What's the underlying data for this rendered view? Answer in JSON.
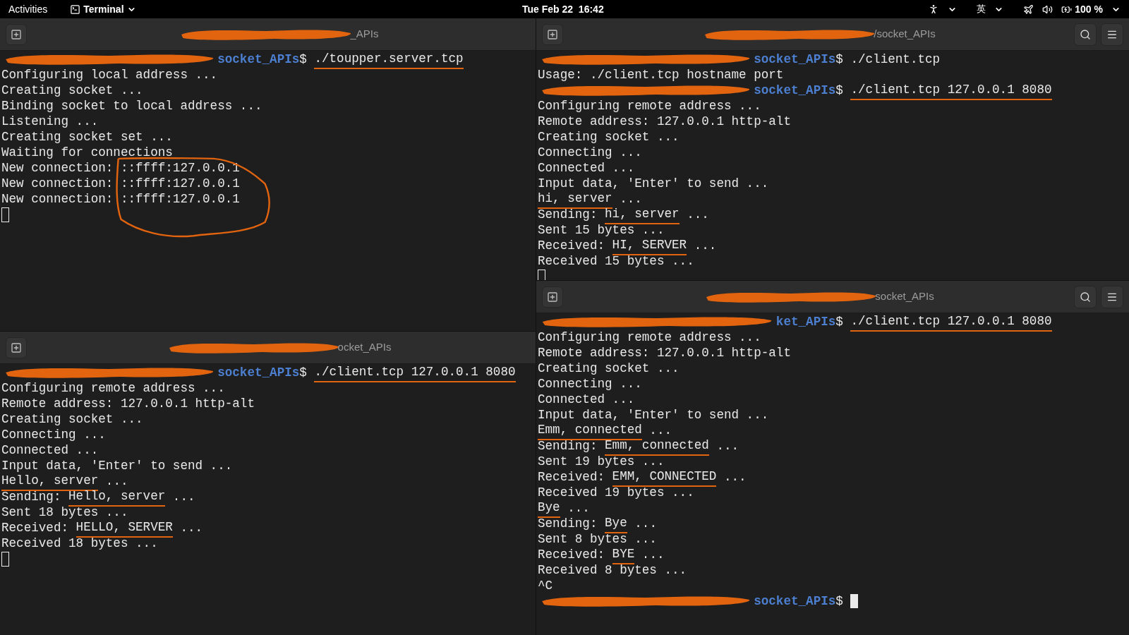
{
  "top_bar": {
    "activities": "Activities",
    "app_menu": "Terminal",
    "clock": "Tue Feb 22  16:42",
    "input_method": "英",
    "battery": "100 %"
  },
  "panes": [
    {
      "title": "_APIs",
      "toolbar_buttons": false,
      "circle_annotation": true,
      "lines": [
        {
          "kind": "prompt",
          "path": "socket_APIs",
          "segments": [
            {
              "text": "$ ",
              "marked": false
            },
            {
              "text": "./toupper.server.tcp",
              "marked": true
            }
          ]
        },
        {
          "kind": "output",
          "segments": [
            {
              "text": "Configuring local address ...",
              "marked": false
            }
          ]
        },
        {
          "kind": "output",
          "segments": [
            {
              "text": "Creating socket ...",
              "marked": false
            }
          ]
        },
        {
          "kind": "output",
          "segments": [
            {
              "text": "Binding socket to local address ...",
              "marked": false
            }
          ]
        },
        {
          "kind": "output",
          "segments": [
            {
              "text": "Listening ...",
              "marked": false
            }
          ]
        },
        {
          "kind": "output",
          "segments": [
            {
              "text": "Creating socket set ...",
              "marked": false
            }
          ]
        },
        {
          "kind": "output",
          "segments": [
            {
              "text": "Waiting for connections",
              "marked": false
            }
          ]
        },
        {
          "kind": "output",
          "segments": [
            {
              "text": "New connection: ::ffff:127.0.0.1",
              "marked": false
            }
          ]
        },
        {
          "kind": "output",
          "segments": [
            {
              "text": "New connection: ::ffff:127.0.0.1",
              "marked": false
            }
          ]
        },
        {
          "kind": "output",
          "segments": [
            {
              "text": "New connection: ::ffff:127.0.0.1",
              "marked": false
            }
          ]
        },
        {
          "kind": "cursor",
          "focused": false
        }
      ]
    },
    {
      "title": "ocket_APIs",
      "toolbar_buttons": false,
      "circle_annotation": false,
      "lines": [
        {
          "kind": "prompt",
          "path": "socket_APIs",
          "segments": [
            {
              "text": "$ ",
              "marked": false
            },
            {
              "text": "./client.tcp 127.0.0.1 8080",
              "marked": true
            }
          ]
        },
        {
          "kind": "output",
          "segments": [
            {
              "text": "Configuring remote address ...",
              "marked": false
            }
          ]
        },
        {
          "kind": "output",
          "segments": [
            {
              "text": "Remote address: 127.0.0.1 http-alt",
              "marked": false
            }
          ]
        },
        {
          "kind": "output",
          "segments": [
            {
              "text": "Creating socket ...",
              "marked": false
            }
          ]
        },
        {
          "kind": "output",
          "segments": [
            {
              "text": "Connecting ...",
              "marked": false
            }
          ]
        },
        {
          "kind": "output",
          "segments": [
            {
              "text": "Connected ...",
              "marked": false
            }
          ]
        },
        {
          "kind": "output",
          "segments": [
            {
              "text": "Input data, 'Enter' to send ...",
              "marked": false
            }
          ]
        },
        {
          "kind": "output",
          "segments": [
            {
              "text": "Hello, server",
              "marked": true
            },
            {
              "text": " ...",
              "marked": false
            }
          ]
        },
        {
          "kind": "output",
          "segments": [
            {
              "text": "Sending: ",
              "marked": false
            },
            {
              "text": "Hello, server",
              "marked": true
            },
            {
              "text": " ...",
              "marked": false
            }
          ]
        },
        {
          "kind": "output",
          "segments": [
            {
              "text": "Sent 18 bytes ...",
              "marked": false
            }
          ]
        },
        {
          "kind": "output",
          "segments": [
            {
              "text": "Received: ",
              "marked": false
            },
            {
              "text": "HELLO, SERVER",
              "marked": true
            },
            {
              "text": " ...",
              "marked": false
            }
          ]
        },
        {
          "kind": "output",
          "segments": [
            {
              "text": "Received 18 bytes ...",
              "marked": false
            }
          ]
        },
        {
          "kind": "cursor",
          "focused": false
        }
      ]
    },
    {
      "title": "/socket_APIs",
      "toolbar_buttons": true,
      "circle_annotation": false,
      "lines": [
        {
          "kind": "prompt",
          "path": "socket_APIs",
          "segments": [
            {
              "text": "$ ./client.tcp",
              "marked": false
            }
          ]
        },
        {
          "kind": "output",
          "segments": [
            {
              "text": "Usage: ./client.tcp hostname port",
              "marked": false
            }
          ]
        },
        {
          "kind": "prompt",
          "path": "socket_APIs",
          "segments": [
            {
              "text": "$ ",
              "marked": false
            },
            {
              "text": "./client.tcp 127.0.0.1 8080",
              "marked": true
            }
          ]
        },
        {
          "kind": "output",
          "segments": [
            {
              "text": "Configuring remote address ...",
              "marked": false
            }
          ]
        },
        {
          "kind": "output",
          "segments": [
            {
              "text": "Remote address: 127.0.0.1 http-alt",
              "marked": false
            }
          ]
        },
        {
          "kind": "output",
          "segments": [
            {
              "text": "Creating socket ...",
              "marked": false
            }
          ]
        },
        {
          "kind": "output",
          "segments": [
            {
              "text": "Connecting ...",
              "marked": false
            }
          ]
        },
        {
          "kind": "output",
          "segments": [
            {
              "text": "Connected ...",
              "marked": false
            }
          ]
        },
        {
          "kind": "output",
          "segments": [
            {
              "text": "Input data, 'Enter' to send ...",
              "marked": false
            }
          ]
        },
        {
          "kind": "output",
          "segments": [
            {
              "text": "hi, server",
              "marked": true
            },
            {
              "text": " ...",
              "marked": false
            }
          ]
        },
        {
          "kind": "output",
          "segments": [
            {
              "text": "Sending: ",
              "marked": false
            },
            {
              "text": "hi, server",
              "marked": true
            },
            {
              "text": " ...",
              "marked": false
            }
          ]
        },
        {
          "kind": "output",
          "segments": [
            {
              "text": "Sent 15 bytes ...",
              "marked": false
            }
          ]
        },
        {
          "kind": "output",
          "segments": [
            {
              "text": "Received: ",
              "marked": false
            },
            {
              "text": "HI, SERVER",
              "marked": true
            },
            {
              "text": " ...",
              "marked": false
            }
          ]
        },
        {
          "kind": "output",
          "segments": [
            {
              "text": "Received 15 bytes ...",
              "marked": false
            }
          ]
        },
        {
          "kind": "cursor",
          "focused": false
        }
      ]
    },
    {
      "title": "socket_APIs",
      "toolbar_buttons": true,
      "circle_annotation": false,
      "lines": [
        {
          "kind": "prompt",
          "path": "ket_APIs",
          "segments": [
            {
              "text": "$ ",
              "marked": false
            },
            {
              "text": "./client.tcp 127.0.0.1 8080",
              "marked": true
            }
          ]
        },
        {
          "kind": "output",
          "segments": [
            {
              "text": "Configuring remote address ...",
              "marked": false
            }
          ]
        },
        {
          "kind": "output",
          "segments": [
            {
              "text": "Remote address: 127.0.0.1 http-alt",
              "marked": false
            }
          ]
        },
        {
          "kind": "output",
          "segments": [
            {
              "text": "Creating socket ...",
              "marked": false
            }
          ]
        },
        {
          "kind": "output",
          "segments": [
            {
              "text": "Connecting ...",
              "marked": false
            }
          ]
        },
        {
          "kind": "output",
          "segments": [
            {
              "text": "Connected ...",
              "marked": false
            }
          ]
        },
        {
          "kind": "output",
          "segments": [
            {
              "text": "Input data, 'Enter' to send ...",
              "marked": false
            }
          ]
        },
        {
          "kind": "output",
          "segments": [
            {
              "text": "Emm, connected",
              "marked": true
            },
            {
              "text": " ...",
              "marked": false
            }
          ]
        },
        {
          "kind": "output",
          "segments": [
            {
              "text": "Sending: ",
              "marked": false
            },
            {
              "text": "Emm, connected",
              "marked": true
            },
            {
              "text": " ...",
              "marked": false
            }
          ]
        },
        {
          "kind": "output",
          "segments": [
            {
              "text": "Sent 19 bytes ...",
              "marked": false
            }
          ]
        },
        {
          "kind": "output",
          "segments": [
            {
              "text": "Received: ",
              "marked": false
            },
            {
              "text": "EMM, CONNECTED",
              "marked": true
            },
            {
              "text": " ...",
              "marked": false
            }
          ]
        },
        {
          "kind": "output",
          "segments": [
            {
              "text": "Received 19 bytes ...",
              "marked": false
            }
          ]
        },
        {
          "kind": "output",
          "segments": [
            {
              "text": "Bye",
              "marked": true
            },
            {
              "text": " ...",
              "marked": false
            }
          ]
        },
        {
          "kind": "output",
          "segments": [
            {
              "text": "Sending: ",
              "marked": false
            },
            {
              "text": "Bye",
              "marked": true
            },
            {
              "text": " ...",
              "marked": false
            }
          ]
        },
        {
          "kind": "output",
          "segments": [
            {
              "text": "Sent 8 bytes ...",
              "marked": false
            }
          ]
        },
        {
          "kind": "output",
          "segments": [
            {
              "text": "Received: ",
              "marked": false
            },
            {
              "text": "BYE",
              "marked": true
            },
            {
              "text": " ...",
              "marked": false
            }
          ]
        },
        {
          "kind": "output",
          "segments": [
            {
              "text": "Received 8 bytes ...",
              "marked": false
            }
          ]
        },
        {
          "kind": "output",
          "segments": [
            {
              "text": "^C",
              "marked": false
            }
          ]
        },
        {
          "kind": "prompt",
          "path": "socket_APIs",
          "segments": [
            {
              "text": "$ ",
              "marked": false
            }
          ],
          "cursor": true
        }
      ]
    }
  ]
}
